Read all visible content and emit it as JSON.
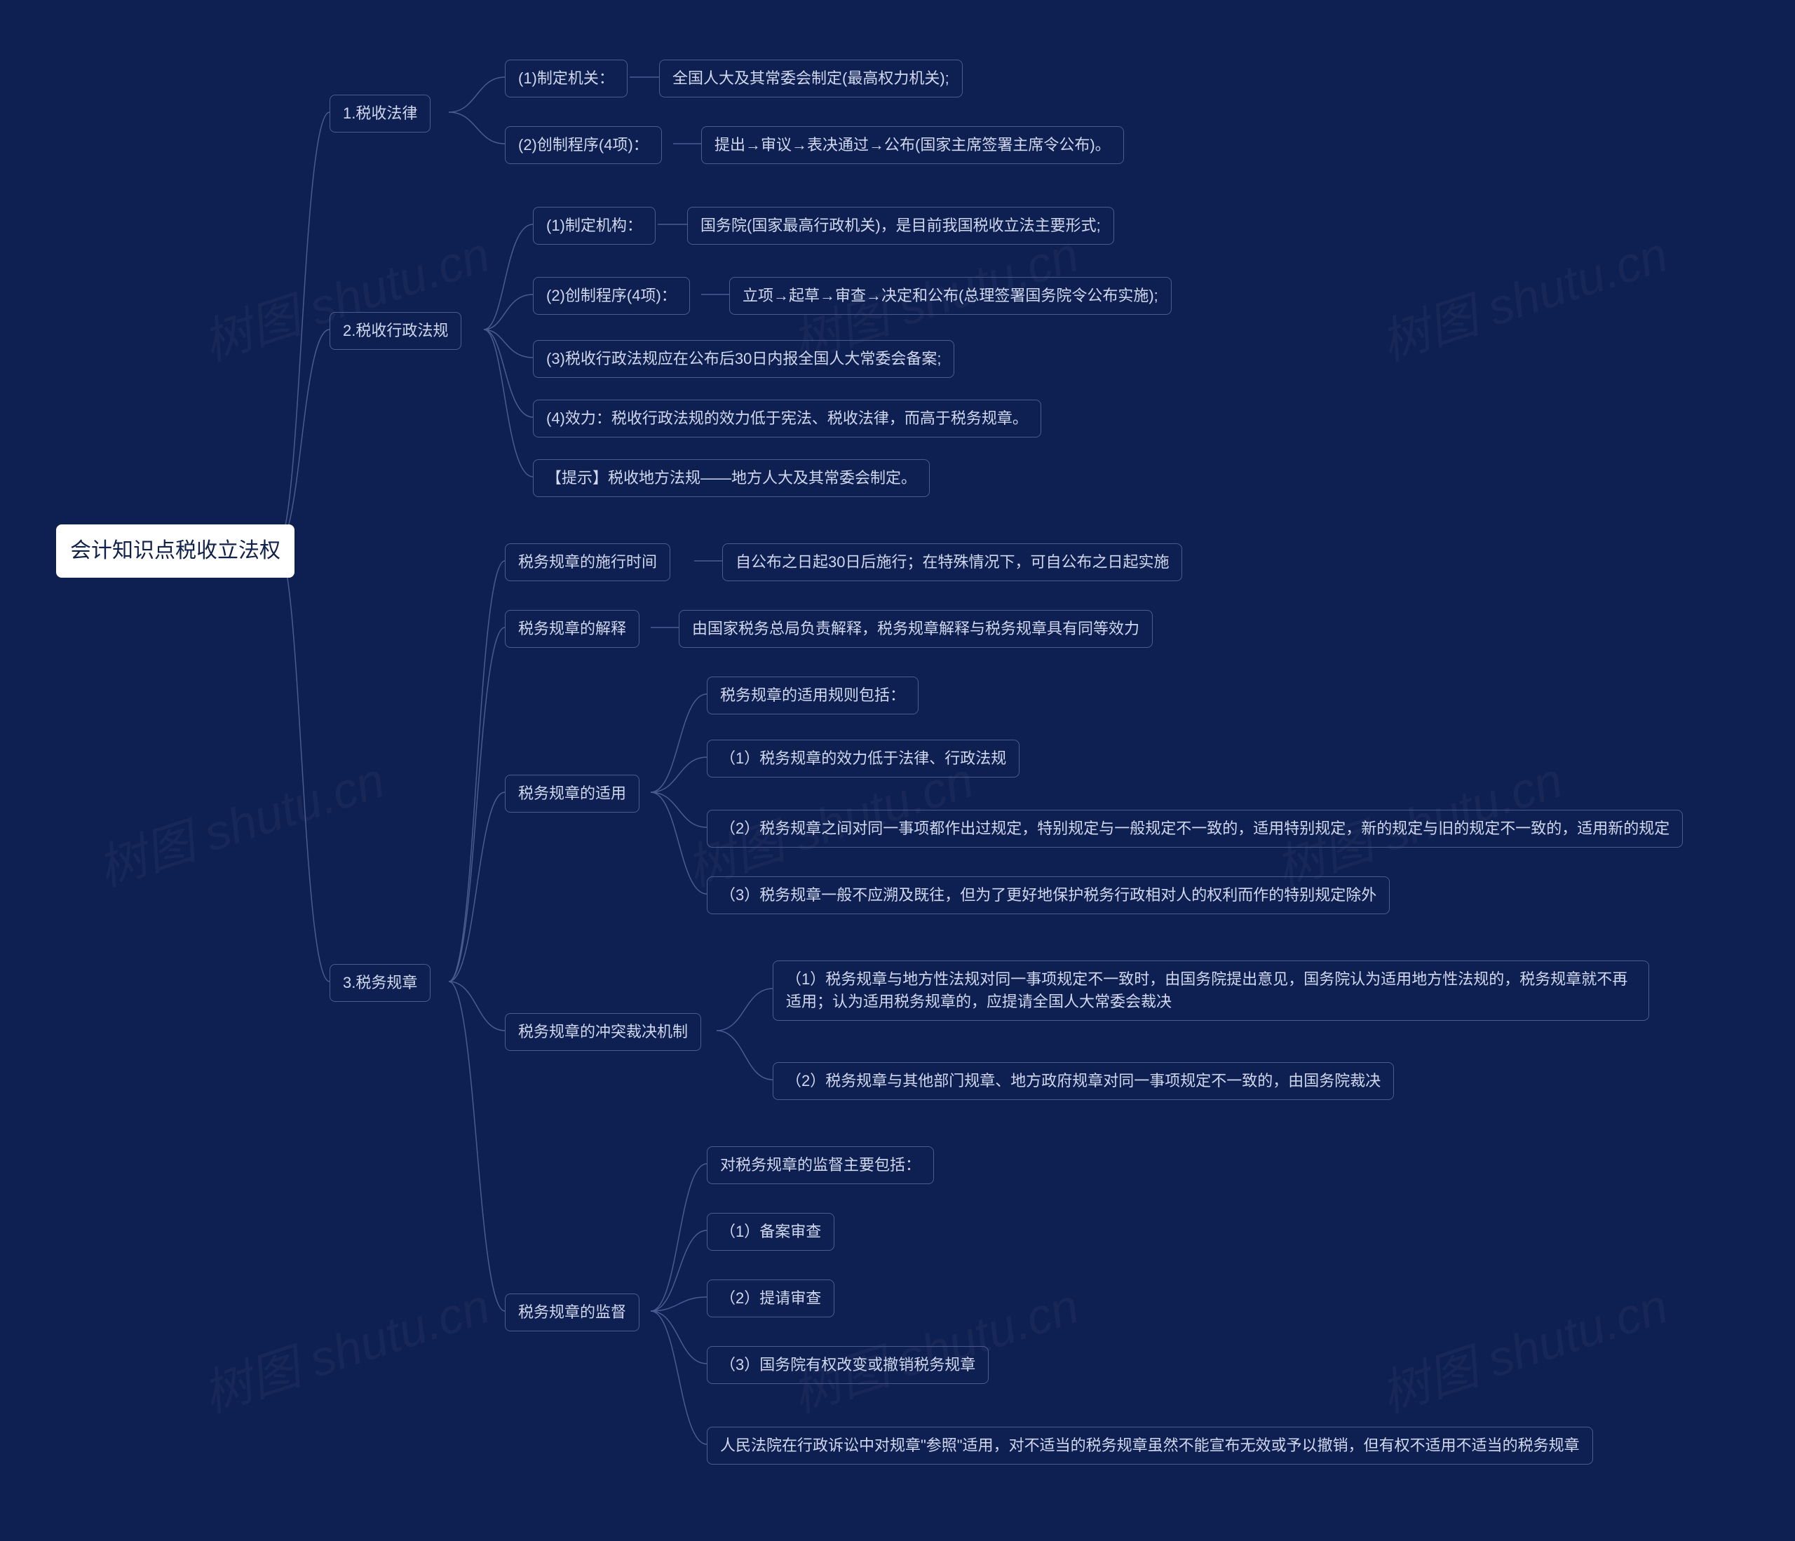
{
  "root": "会计知识点税收立法权",
  "branch1": {
    "title": "1.税收法律",
    "n1": "(1)制定机关：",
    "n1a": "全国人大及其常委会制定(最高权力机关);",
    "n2": "(2)创制程序(4项)：",
    "n2a": "提出→审议→表决通过→公布(国家主席签署主席令公布)。"
  },
  "branch2": {
    "title": "2.税收行政法规",
    "n1": "(1)制定机构：",
    "n1a": "国务院(国家最高行政机关)，是目前我国税收立法主要形式;",
    "n2": "(2)创制程序(4项)：",
    "n2a": "立项→起草→审查→决定和公布(总理签署国务院令公布实施);",
    "n3": "(3)税收行政法规应在公布后30日内报全国人大常委会备案;",
    "n4": "(4)效力：税收行政法规的效力低于宪法、税收法律，而高于税务规章。",
    "n5": "【提示】税收地方法规——地方人大及其常委会制定。"
  },
  "branch3": {
    "title": "3.税务规章",
    "g1": {
      "label": "税务规章的施行时间",
      "leaf": "自公布之日起30日后施行；在特殊情况下，可自公布之日起实施"
    },
    "g2": {
      "label": "税务规章的解释",
      "leaf": "由国家税务总局负责解释，税务规章解释与税务规章具有同等效力"
    },
    "g3": {
      "label": "税务规章的适用",
      "l1": "税务规章的适用规则包括：",
      "l2": "（1）税务规章的效力低于法律、行政法规",
      "l3": "（2）税务规章之间对同一事项都作出过规定，特别规定与一般规定不一致的，适用特别规定，新的规定与旧的规定不一致的，适用新的规定",
      "l4": "（3）税务规章一般不应溯及既往，但为了更好地保护税务行政相对人的权利而作的特别规定除外"
    },
    "g4": {
      "label": "税务规章的冲突裁决机制",
      "l1": "（1）税务规章与地方性法规对同一事项规定不一致时，由国务院提出意见，国务院认为适用地方性法规的，税务规章就不再适用；认为适用税务规章的，应提请全国人大常委会裁决",
      "l2": "（2）税务规章与其他部门规章、地方政府规章对同一事项规定不一致的，由国务院裁决"
    },
    "g5": {
      "label": "税务规章的监督",
      "l1": "对税务规章的监督主要包括：",
      "l2": "（1）备案审查",
      "l3": "（2）提请审查",
      "l4": "（3）国务院有权改变或撤销税务规章",
      "l5": "人民法院在行政诉讼中对规章\"参照\"适用，对不适当的税务规章虽然不能宣布无效或予以撤销，但有权不适用不适当的税务规章"
    }
  },
  "watermark": "树图 shutu.cn"
}
